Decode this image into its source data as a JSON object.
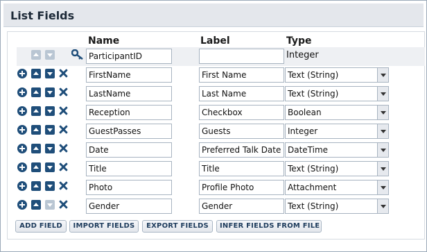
{
  "panel": {
    "title": "List Fields"
  },
  "columns": {
    "name": "Name",
    "label": "Label",
    "type": "Type"
  },
  "pk_row": {
    "name": "ParticipantID",
    "label": "",
    "type": "Integer"
  },
  "rows": [
    {
      "name": "FirstName",
      "label": "First Name",
      "type": "Text (String)"
    },
    {
      "name": "LastName",
      "label": "Last Name",
      "type": "Text (String)"
    },
    {
      "name": "Reception",
      "label": "Checkbox",
      "type": "Boolean"
    },
    {
      "name": "GuestPasses",
      "label": "Guests",
      "type": "Integer"
    },
    {
      "name": "Date",
      "label": "Preferred Talk Date",
      "type": "DateTime"
    },
    {
      "name": "Title",
      "label": "Title",
      "type": "Text (String)"
    },
    {
      "name": "Photo",
      "label": "Profile Photo",
      "type": "Attachment"
    },
    {
      "name": "Gender",
      "label": "Gender",
      "type": "Text (String)"
    }
  ],
  "buttons": {
    "add_field": "ADD FIELD",
    "import_fields": "IMPORT FIELDS",
    "export_fields": "EXPORT FIELDS",
    "infer_fields": "INFER FIELDS FROM FILE"
  },
  "colors": {
    "accent": "#1f4e7a",
    "disabled": "#b9c6d3",
    "header_bg": "#e4e7ec"
  }
}
